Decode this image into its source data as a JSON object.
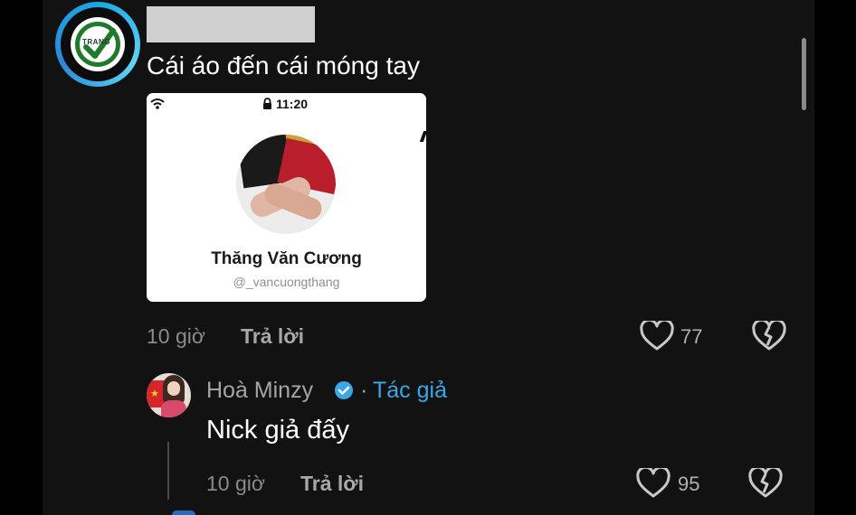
{
  "scrollbar": {
    "position": "top"
  },
  "comment1": {
    "author_avatar": {
      "brand": "TRANG",
      "icon": "green-check-icon"
    },
    "text": "Cái áo đến cái móng tay",
    "attachment": {
      "status_time": "11:20",
      "profile_name": "Thăng Văn Cương",
      "profile_handle": "@_vancuongthang"
    },
    "time": "10 giờ",
    "reply_label": "Trả lời",
    "likes": "77"
  },
  "comment2": {
    "author": "Hoà Minzy",
    "separator": "·",
    "author_tag": "Tác giả",
    "text": "Nick giả đấy",
    "time": "10 giờ",
    "reply_label": "Trả lời",
    "likes": "95"
  },
  "colors": {
    "background": "#121212",
    "accent": "#3aa7e7",
    "muted": "#8a8a8a"
  }
}
